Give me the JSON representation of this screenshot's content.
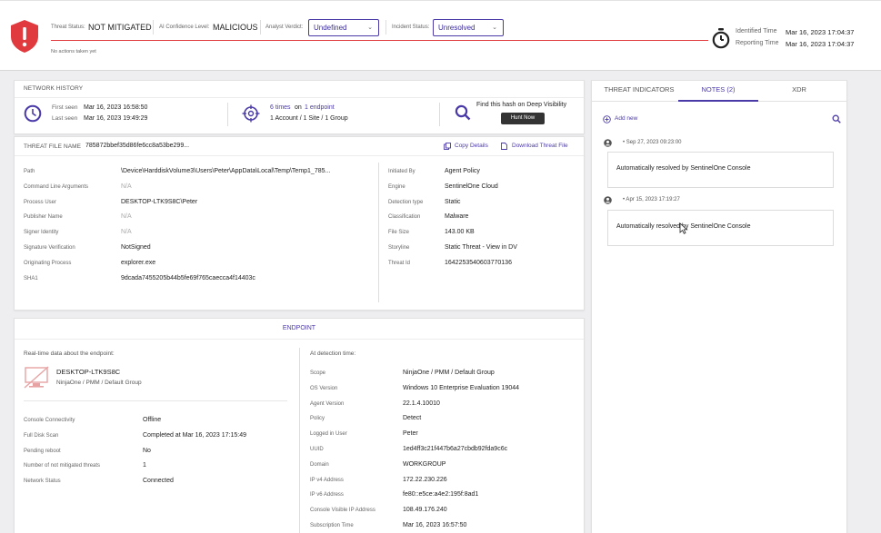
{
  "header": {
    "threat_status_label": "Threat Status:",
    "threat_status": "NOT MITIGATED",
    "ai_confidence_label": "AI Confidence Level:",
    "ai_confidence": "MALICIOUS",
    "analyst_verdict_label": "Analyst Verdict:",
    "analyst_verdict": "Undefined",
    "incident_status_label": "Incident Status:",
    "incident_status": "Unresolved",
    "actions_note": "No actions taken yet",
    "identified_label": "Identified Time",
    "identified_time": "Mar 16, 2023 17:04:37",
    "reporting_label": "Reporting Time",
    "reporting_time": "Mar 16, 2023 17:04:37",
    "colors": {
      "accent": "#4a3aa8",
      "danger": "#e03a3e"
    }
  },
  "network_history": {
    "title": "NETWORK HISTORY",
    "first_seen_label": "First seen",
    "first_seen": "Mar 16, 2023 16:58:50",
    "last_seen_label": "Last seen",
    "last_seen": "Mar 16, 2023 19:49:29",
    "times_link": "6 times",
    "on_label": "on",
    "endpoint_link": "1 endpoint",
    "scope": "1 Account / 1 Site / 1 Group",
    "hunt_text": "Find this hash on Deep Visibility",
    "hunt_button": "Hunt Now"
  },
  "threat_file": {
    "label": "THREAT FILE NAME",
    "name": "785872bbef35d86fe6cc8a53be299...",
    "copy_details": "Copy Details",
    "download": "Download Threat File",
    "left_fields": [
      {
        "k": "Path",
        "v": "\\Device\\HarddiskVolume3\\Users\\Peter\\AppData\\Local\\Temp\\Temp1_785..."
      },
      {
        "k": "Command Line Arguments",
        "v": "N/A"
      },
      {
        "k": "Process User",
        "v": "DESKTOP-LTK9S8C\\Peter"
      },
      {
        "k": "Publisher Name",
        "v": "N/A"
      },
      {
        "k": "Signer Identity",
        "v": "N/A"
      },
      {
        "k": "Signature Verification",
        "v": "NotSigned"
      },
      {
        "k": "Originating Process",
        "v": "explorer.exe"
      },
      {
        "k": "SHA1",
        "v": "9dcada7455205b44b5fe69f765caecca4f14403c"
      }
    ],
    "right_fields": [
      {
        "k": "Initiated By",
        "v": "Agent Policy"
      },
      {
        "k": "Engine",
        "v": "SentinelOne Cloud"
      },
      {
        "k": "Detection type",
        "v": "Static"
      },
      {
        "k": "Classification",
        "v": "Malware"
      },
      {
        "k": "File Size",
        "v": "143.00 KB"
      },
      {
        "k": "Storyline",
        "v": "Static Threat - View in DV"
      },
      {
        "k": "Threat Id",
        "v": "1642253540603770136"
      }
    ]
  },
  "endpoint": {
    "title": "ENDPOINT",
    "realtime_label": "Real-time data about the endpoint:",
    "detection_label": "At detection time:",
    "name": "DESKTOP-LTK9S8C",
    "group": "NinjaOne / PMM / Default Group",
    "left_fields": [
      {
        "k": "Console Connectivity",
        "v": "Offline"
      },
      {
        "k": "Full Disk Scan",
        "v": "Completed at Mar 16, 2023 17:15:49"
      },
      {
        "k": "Pending reboot",
        "v": "No"
      },
      {
        "k": "Number of not mitigated threats",
        "v": "1"
      },
      {
        "k": "Network Status",
        "v": "Connected"
      }
    ],
    "right_fields": [
      {
        "k": "Scope",
        "v": "NinjaOne / PMM / Default Group"
      },
      {
        "k": "OS Version",
        "v": "Windows 10 Enterprise Evaluation 19044"
      },
      {
        "k": "Agent Version",
        "v": "22.1.4.10010"
      },
      {
        "k": "Policy",
        "v": "Detect"
      },
      {
        "k": "Logged in User",
        "v": "Peter"
      },
      {
        "k": "UUID",
        "v": "1ed4ff3c21f447b6a27cbdb92fda9c6c"
      },
      {
        "k": "Domain",
        "v": "WORKGROUP"
      },
      {
        "k": "IP v4 Address",
        "v": "172.22.230.226"
      },
      {
        "k": "IP v6 Address",
        "v": "fe80::e5ce:a4e2:195f:8ad1"
      },
      {
        "k": "Console Visible IP Address",
        "v": "108.49.176.240"
      },
      {
        "k": "Subscription Time",
        "v": "Mar 16, 2023 16:57:50"
      }
    ]
  },
  "side": {
    "tabs": [
      "THREAT INDICATORS",
      "NOTES (2)",
      "XDR"
    ],
    "add_new": "Add new",
    "notes": [
      {
        "time": "• Sep 27, 2023 09:23:00",
        "text": "Automatically resolved by SentinelOne Console"
      },
      {
        "time": "• Apr 15, 2023 17:19:27",
        "text": "Automatically resolved by SentinelOne Console"
      }
    ]
  }
}
